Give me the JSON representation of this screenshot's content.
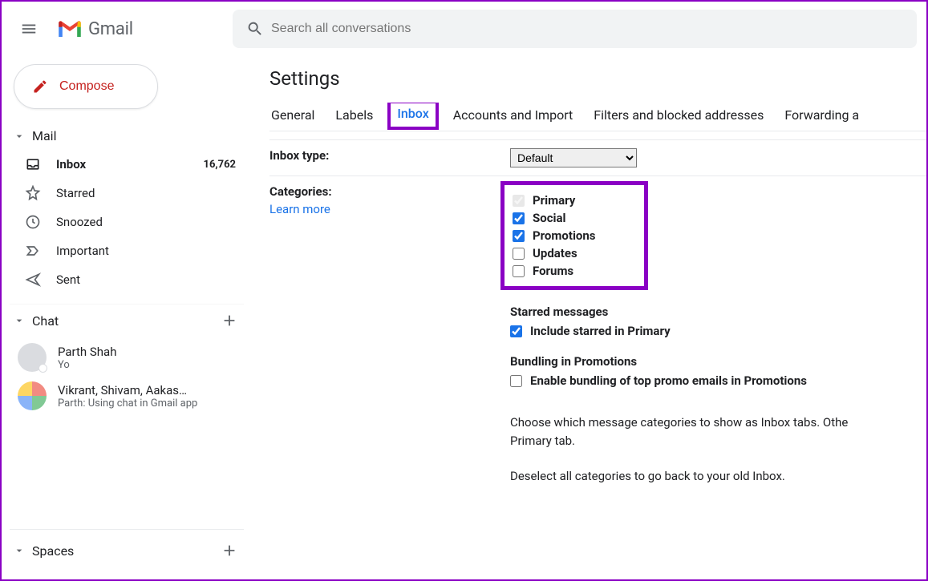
{
  "header": {
    "app_name": "Gmail",
    "search_placeholder": "Search all conversations"
  },
  "compose_label": "Compose",
  "mail_section": {
    "title": "Mail",
    "items": [
      {
        "icon": "inbox",
        "label": "Inbox",
        "count": "16,762",
        "active": true
      },
      {
        "icon": "star",
        "label": "Starred",
        "count": ""
      },
      {
        "icon": "clock",
        "label": "Snoozed",
        "count": ""
      },
      {
        "icon": "important",
        "label": "Important",
        "count": ""
      },
      {
        "icon": "send",
        "label": "Sent",
        "count": ""
      }
    ]
  },
  "chat_section": {
    "title": "Chat",
    "items": [
      {
        "name": "Parth Shah",
        "sub": "Yo",
        "group": false
      },
      {
        "name": "Vikrant, Shivam, Aakas…",
        "sub": "Parth: Using chat in Gmail app",
        "group": true
      }
    ]
  },
  "spaces_section": {
    "title": "Spaces"
  },
  "settings": {
    "title": "Settings",
    "tabs": [
      "General",
      "Labels",
      "Inbox",
      "Accounts and Import",
      "Filters and blocked addresses",
      "Forwarding a"
    ],
    "active_tab": "Inbox",
    "inbox_type": {
      "label": "Inbox type:",
      "value": "Default"
    },
    "categories": {
      "label": "Categories:",
      "learn_more": "Learn more",
      "items": [
        {
          "label": "Primary",
          "checked": true,
          "locked": true
        },
        {
          "label": "Social",
          "checked": true
        },
        {
          "label": "Promotions",
          "checked": true
        },
        {
          "label": "Updates",
          "checked": false
        },
        {
          "label": "Forums",
          "checked": false
        }
      ],
      "starred_head": "Starred messages",
      "starred_opt": "Include starred in Primary",
      "bundling_head": "Bundling in Promotions",
      "bundling_opt": "Enable bundling of top promo emails in Promotions",
      "desc1": "Choose which message categories to show as Inbox tabs. Othe",
      "desc1b": "Primary tab.",
      "desc2": "Deselect all categories to go back to your old Inbox."
    }
  }
}
